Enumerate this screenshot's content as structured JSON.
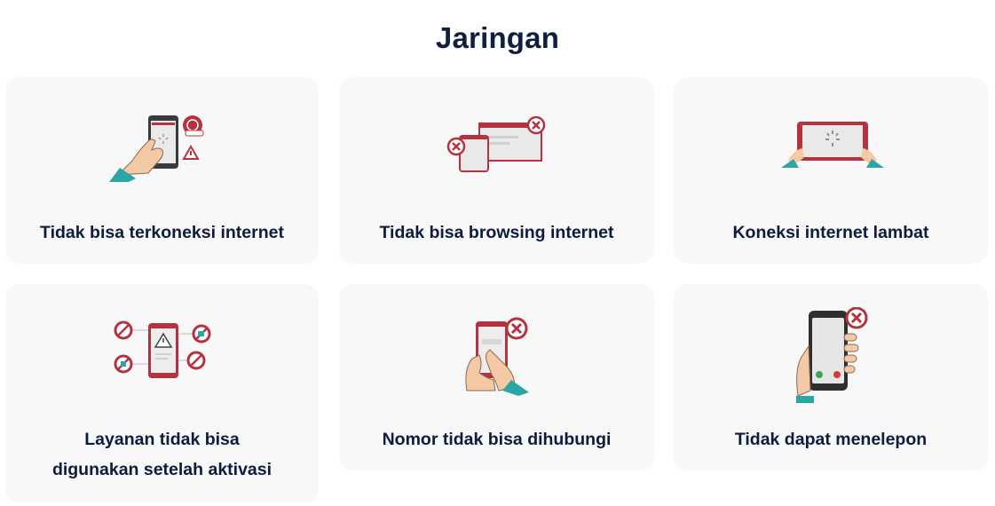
{
  "page": {
    "title": "Jaringan"
  },
  "cards": [
    {
      "label": "Tidak bisa terkoneksi internet",
      "icon": "phone-touch-globe-warning-icon"
    },
    {
      "label": "Tidak bisa browsing internet",
      "icon": "browser-windows-error-icon"
    },
    {
      "label": "Koneksi internet lambat",
      "icon": "tablet-loading-icon"
    },
    {
      "label": "Layanan tidak bisa digunakan setelah aktivasi",
      "label_line1": "Layanan tidak bisa",
      "label_line2": "digunakan setelah aktivasi",
      "icon": "phone-blocked-services-icon"
    },
    {
      "label": "Nomor tidak bisa dihubungi",
      "icon": "phone-dial-error-icon"
    },
    {
      "label": "Tidak dapat menelepon",
      "icon": "phone-call-blocked-icon"
    }
  ],
  "colors": {
    "title": "#0f1f3d",
    "card_bg": "#f8f8f8",
    "accent_red": "#b5333f",
    "accent_teal": "#2aa7a4",
    "skin": "#f4c9a5"
  }
}
